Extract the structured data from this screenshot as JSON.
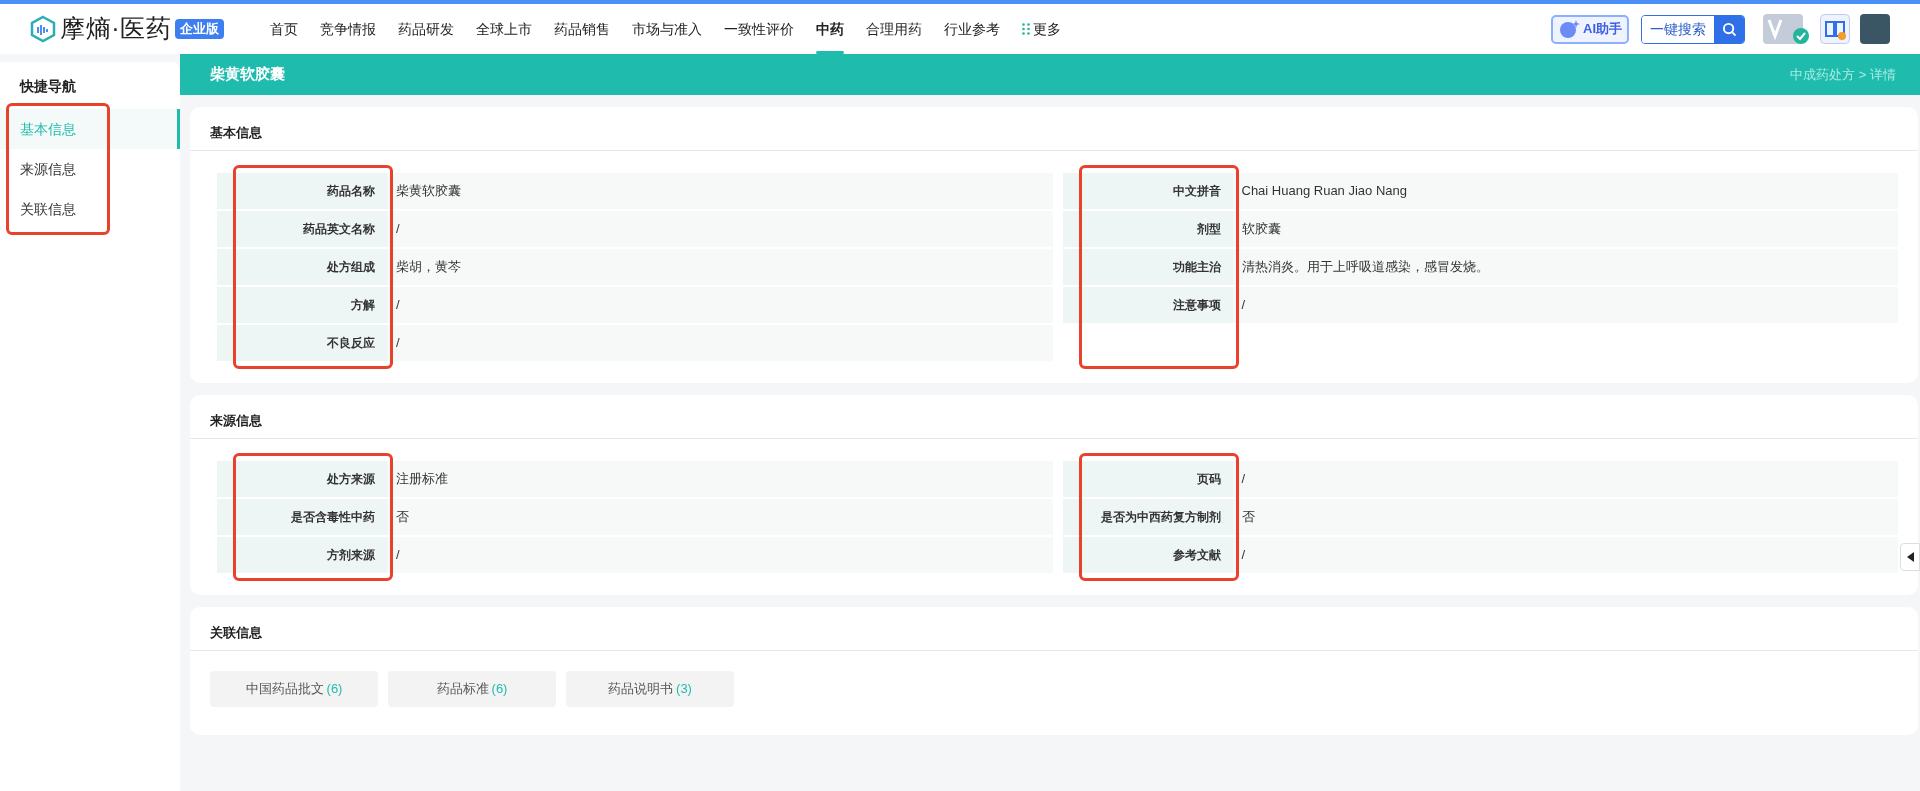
{
  "header": {
    "logo": {
      "text": "摩熵·医药",
      "badge": "企业版"
    },
    "nav": [
      {
        "label": "首页",
        "selected": false,
        "kind": "link"
      },
      {
        "label": "竞争情报",
        "selected": false,
        "kind": "link"
      },
      {
        "label": "药品研发",
        "selected": false,
        "kind": "link"
      },
      {
        "label": "全球上市",
        "selected": false,
        "kind": "link"
      },
      {
        "label": "药品销售",
        "selected": false,
        "kind": "link"
      },
      {
        "label": "市场与准入",
        "selected": false,
        "kind": "link"
      },
      {
        "label": "一致性评价",
        "selected": false,
        "kind": "link"
      },
      {
        "label": "中药",
        "selected": true,
        "kind": "link"
      },
      {
        "label": "合理用药",
        "selected": false,
        "kind": "link"
      },
      {
        "label": "行业参考",
        "selected": false,
        "kind": "link"
      },
      {
        "label": "更多",
        "selected": false,
        "kind": "more"
      }
    ],
    "ai_button": "AI助手",
    "search_button": "一键搜索"
  },
  "sidebar": {
    "title": "快捷导航",
    "highlighted": true,
    "items": [
      {
        "label": "基本信息",
        "selected": true
      },
      {
        "label": "来源信息",
        "selected": false
      },
      {
        "label": "关联信息",
        "selected": false
      }
    ]
  },
  "page": {
    "title": "柴黄软胶囊",
    "breadcrumb": "中成药处方 > 详情"
  },
  "sections": [
    {
      "kind": "fields",
      "title": "基本信息",
      "columns": [
        {
          "highlighted": true,
          "fields": [
            {
              "label": "药品名称",
              "value": "柴黄软胶囊"
            },
            {
              "label": "药品英文名称",
              "value": "/"
            },
            {
              "label": "处方组成",
              "value": "柴胡，黄芩"
            },
            {
              "label": "方解",
              "value": "/"
            },
            {
              "label": "不良反应",
              "value": "/"
            }
          ]
        },
        {
          "highlighted": true,
          "fields": [
            {
              "label": "中文拼音",
              "value": "Chai Huang Ruan Jiao Nang"
            },
            {
              "label": "剂型",
              "value": "软胶囊"
            },
            {
              "label": "功能主治",
              "value": "清热消炎。用于上呼吸道感染，感冒发烧。"
            },
            {
              "label": "注意事项",
              "value": "/"
            }
          ]
        }
      ]
    },
    {
      "kind": "fields",
      "title": "来源信息",
      "columns": [
        {
          "highlighted": true,
          "fields": [
            {
              "label": "处方来源",
              "value": "注册标准"
            },
            {
              "label": "是否含毒性中药",
              "value": "否"
            },
            {
              "label": "方剂来源",
              "value": "/"
            }
          ]
        },
        {
          "highlighted": true,
          "fields": [
            {
              "label": "页码",
              "value": "/"
            },
            {
              "label": "是否为中西药复方制剂",
              "value": "否"
            },
            {
              "label": "参考文献",
              "value": "/"
            }
          ]
        }
      ]
    },
    {
      "kind": "links",
      "title": "关联信息",
      "links": [
        {
          "label": "中国药品批文",
          "count": "(6)"
        },
        {
          "label": "药品标准",
          "count": "(6)"
        },
        {
          "label": "药品说明书",
          "count": "(3)"
        }
      ]
    }
  ]
}
